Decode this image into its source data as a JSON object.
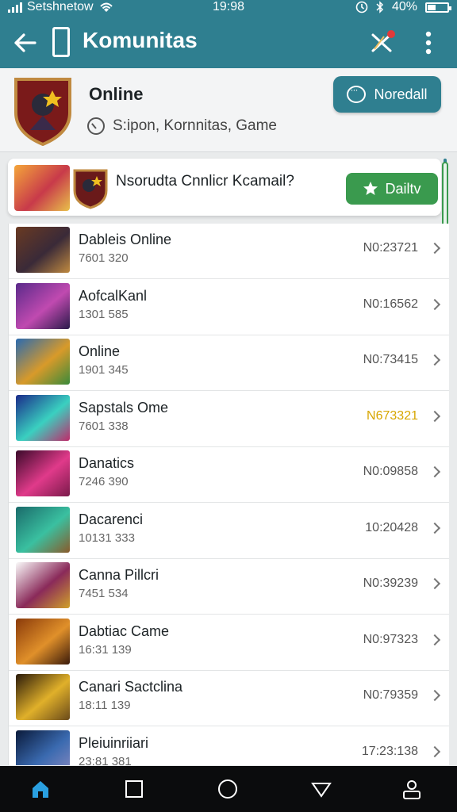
{
  "status": {
    "carrier": "Setshnetow",
    "time": "19:98",
    "battery": "40%"
  },
  "appbar": {
    "title": "Komunitas"
  },
  "header": {
    "name": "Online",
    "subtitle": "S:ipon, Kornnitas, Game",
    "button_label": "Noredall"
  },
  "promo": {
    "text": "Nsorudta Cnnlicr Kcamail?",
    "button_label": "Dailtv"
  },
  "games": [
    {
      "name": "Dableis Online",
      "count": "7601 320",
      "code": "N0:23721",
      "highlight": false,
      "colors": [
        "#6a3a22",
        "#3a2a38",
        "#c08a40"
      ]
    },
    {
      "name": "AofcalKanl",
      "count": "1301 585",
      "code": "N0:16562",
      "highlight": false,
      "colors": [
        "#5a2a8a",
        "#c04ab0",
        "#2a1a4a"
      ]
    },
    {
      "name": "Online",
      "count": "1901 345",
      "code": "N0:73415",
      "highlight": false,
      "colors": [
        "#2a6ab0",
        "#d89a2a",
        "#3a8a3a"
      ]
    },
    {
      "name": "Sapstals Ome",
      "count": "7601 338",
      "code": "N673321",
      "highlight": true,
      "colors": [
        "#1a2a8a",
        "#3ad0c0",
        "#c02a6a"
      ]
    },
    {
      "name": "Danatics",
      "count": "7246 390",
      "code": "N0:09858",
      "highlight": false,
      "colors": [
        "#3a0a2a",
        "#e03a8a",
        "#7a1a4a"
      ]
    },
    {
      "name": "Dacarenci",
      "count": "10131 333",
      "code": "10:20428",
      "highlight": false,
      "colors": [
        "#1a6a6a",
        "#3ac0a0",
        "#8a5a2a"
      ]
    },
    {
      "name": "Canna Pillcri",
      "count": "7451 534",
      "code": "N0:39239",
      "highlight": false,
      "colors": [
        "#fafafa",
        "#8a2a5a",
        "#d0a02a"
      ]
    },
    {
      "name": "Dabtiac Came",
      "count": "16:31 139",
      "code": "N0:97323",
      "highlight": false,
      "colors": [
        "#8a3a0a",
        "#e0902a",
        "#3a1a0a"
      ]
    },
    {
      "name": "Canari Sactclina",
      "count": "18:11 139",
      "code": "N0:79359",
      "highlight": false,
      "colors": [
        "#2a1a0a",
        "#e0b02a",
        "#6a4a1a"
      ]
    },
    {
      "name": "Pleiuinriiari",
      "count": "23:81 381",
      "code": "17:23:138",
      "highlight": false,
      "colors": [
        "#0a1a3a",
        "#3a6ab0",
        "#8a8ac0"
      ]
    }
  ],
  "colors": {
    "primary": "#2f7f90",
    "accent_green": "#3a9a4e",
    "highlight": "#d7a600",
    "nav_bg": "#0b0c0d",
    "nav_active": "#2aa0e0"
  },
  "icons": {
    "back": "arrow-left-icon",
    "phone": "phone-outline-icon",
    "notifications": "notification-x-icon",
    "more": "more-vertical-icon",
    "nav": [
      "home-icon",
      "square-icon",
      "circle-icon",
      "triangle-icon",
      "profile-icon"
    ]
  }
}
